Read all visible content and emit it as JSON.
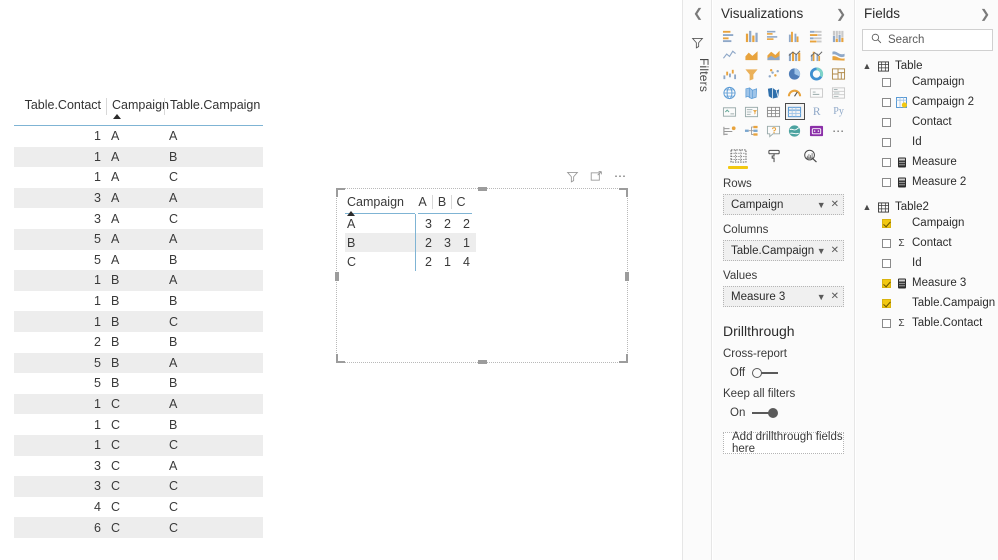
{
  "left_table": {
    "name": "data-table",
    "columns": [
      "Table.Contact",
      "Campaign",
      "Table.Campaign"
    ],
    "sorted_column": "Campaign",
    "sort_direction": "ascending",
    "rows": [
      [
        "1",
        "A",
        "A"
      ],
      [
        "1",
        "A",
        "B"
      ],
      [
        "1",
        "A",
        "C"
      ],
      [
        "3",
        "A",
        "A"
      ],
      [
        "3",
        "A",
        "C"
      ],
      [
        "5",
        "A",
        "A"
      ],
      [
        "5",
        "A",
        "B"
      ],
      [
        "1",
        "B",
        "A"
      ],
      [
        "1",
        "B",
        "B"
      ],
      [
        "1",
        "B",
        "C"
      ],
      [
        "2",
        "B",
        "B"
      ],
      [
        "5",
        "B",
        "A"
      ],
      [
        "5",
        "B",
        "B"
      ],
      [
        "1",
        "C",
        "A"
      ],
      [
        "1",
        "C",
        "B"
      ],
      [
        "1",
        "C",
        "C"
      ],
      [
        "3",
        "C",
        "A"
      ],
      [
        "3",
        "C",
        "C"
      ],
      [
        "4",
        "C",
        "C"
      ],
      [
        "6",
        "C",
        "C"
      ]
    ]
  },
  "matrix_visual": {
    "row_header": "Campaign",
    "sort_direction": "ascending",
    "column_headers": [
      "A",
      "B",
      "C"
    ],
    "row_labels": [
      "A",
      "B",
      "C"
    ],
    "values": [
      [
        "3",
        "2",
        "2"
      ],
      [
        "2",
        "3",
        "1"
      ],
      [
        "2",
        "1",
        "4"
      ]
    ],
    "highlighted_row_index": 1,
    "header_icons": [
      "filter-icon",
      "focus-mode-icon",
      "more-options-icon"
    ]
  },
  "filters_rail": {
    "label": "Filters",
    "collapse_icon": "chevron-left-icon",
    "filter_icon": "filter-icon"
  },
  "visualizations": {
    "title": "Visualizations",
    "expand_icon": "chevron-right-icon",
    "gallery": [
      {
        "name": "stacked-bar-chart-icon",
        "selected": false
      },
      {
        "name": "stacked-column-chart-icon",
        "selected": false
      },
      {
        "name": "clustered-bar-chart-icon",
        "selected": false
      },
      {
        "name": "clustered-column-chart-icon",
        "selected": false
      },
      {
        "name": "100-stacked-bar-chart-icon",
        "selected": false
      },
      {
        "name": "100-stacked-column-chart-icon",
        "selected": false
      },
      {
        "name": "line-chart-icon",
        "selected": false
      },
      {
        "name": "area-chart-icon",
        "selected": false
      },
      {
        "name": "stacked-area-chart-icon",
        "selected": false
      },
      {
        "name": "line-stacked-column-chart-icon",
        "selected": false
      },
      {
        "name": "line-clustered-column-chart-icon",
        "selected": false
      },
      {
        "name": "ribbon-chart-icon",
        "selected": false
      },
      {
        "name": "waterfall-chart-icon",
        "selected": false
      },
      {
        "name": "funnel-chart-icon",
        "selected": false
      },
      {
        "name": "scatter-chart-icon",
        "selected": false
      },
      {
        "name": "pie-chart-icon",
        "selected": false
      },
      {
        "name": "donut-chart-icon",
        "selected": false
      },
      {
        "name": "treemap-icon",
        "selected": false
      },
      {
        "name": "map-icon",
        "selected": false
      },
      {
        "name": "filled-map-icon",
        "selected": false
      },
      {
        "name": "shape-map-icon",
        "selected": false
      },
      {
        "name": "gauge-icon",
        "selected": false
      },
      {
        "name": "card-icon",
        "selected": false
      },
      {
        "name": "multi-row-card-icon",
        "selected": false
      },
      {
        "name": "kpi-icon",
        "selected": false
      },
      {
        "name": "slicer-icon",
        "selected": false
      },
      {
        "name": "table-icon",
        "selected": false
      },
      {
        "name": "matrix-icon",
        "selected": true
      },
      {
        "name": "r-script-visual-icon",
        "label": "R",
        "selected": false
      },
      {
        "name": "python-visual-icon",
        "label": "Py",
        "selected": false
      },
      {
        "name": "key-influencers-icon",
        "selected": false
      },
      {
        "name": "decomposition-tree-icon",
        "selected": false
      },
      {
        "name": "qna-visual-icon",
        "selected": false
      },
      {
        "name": "arcgis-maps-icon",
        "selected": false
      },
      {
        "name": "paginated-report-icon",
        "selected": false
      },
      {
        "name": "more-visuals-icon",
        "label": "⋯",
        "selected": false
      }
    ],
    "tabs": [
      {
        "name": "fields-tab",
        "icon": "fields-grid-icon",
        "active": true
      },
      {
        "name": "format-tab",
        "icon": "paint-roller-icon",
        "active": false
      },
      {
        "name": "analytics-tab",
        "icon": "analytics-magnifier-icon",
        "active": false
      }
    ],
    "wells": [
      {
        "label": "Rows",
        "field": "Campaign"
      },
      {
        "label": "Columns",
        "field": "Table.Campaign"
      },
      {
        "label": "Values",
        "field": "Measure 3"
      }
    ],
    "drillthrough": {
      "title": "Drillthrough",
      "cross_report": {
        "label": "Cross-report",
        "state": "Off",
        "on": false
      },
      "keep_all_filters": {
        "label": "Keep all filters",
        "state": "On",
        "on": true
      },
      "dropzone": "Add drillthrough fields here"
    }
  },
  "fields": {
    "title": "Fields",
    "expand_icon": "chevron-right-icon",
    "search": {
      "placeholder": "Search",
      "value": "",
      "icon": "search-icon"
    },
    "tables": [
      {
        "name": "Table",
        "expanded": true,
        "icon": "table-icon",
        "items": [
          {
            "label": "Campaign",
            "checked": false,
            "icon": ""
          },
          {
            "label": "Campaign 2",
            "checked": false,
            "icon": "calculated-column-icon"
          },
          {
            "label": "Contact",
            "checked": false,
            "icon": ""
          },
          {
            "label": "Id",
            "checked": false,
            "icon": ""
          },
          {
            "label": "Measure",
            "checked": false,
            "icon": "measure-icon"
          },
          {
            "label": "Measure 2",
            "checked": false,
            "icon": "measure-icon"
          }
        ]
      },
      {
        "name": "Table2",
        "expanded": true,
        "icon": "table-icon",
        "items": [
          {
            "label": "Campaign",
            "checked": true,
            "icon": ""
          },
          {
            "label": "Contact",
            "checked": false,
            "icon": "sigma-icon"
          },
          {
            "label": "Id",
            "checked": false,
            "icon": ""
          },
          {
            "label": "Measure 3",
            "checked": true,
            "icon": "measure-icon"
          },
          {
            "label": "Table.Campaign",
            "checked": true,
            "icon": ""
          },
          {
            "label": "Table.Contact",
            "checked": false,
            "icon": "sigma-icon"
          }
        ]
      }
    ]
  },
  "colors": {
    "accent_yellow": "#f2c811",
    "rule_blue": "#7fb4d4",
    "band_gray": "#ededed",
    "pane_bg": "#fbfbfb"
  }
}
